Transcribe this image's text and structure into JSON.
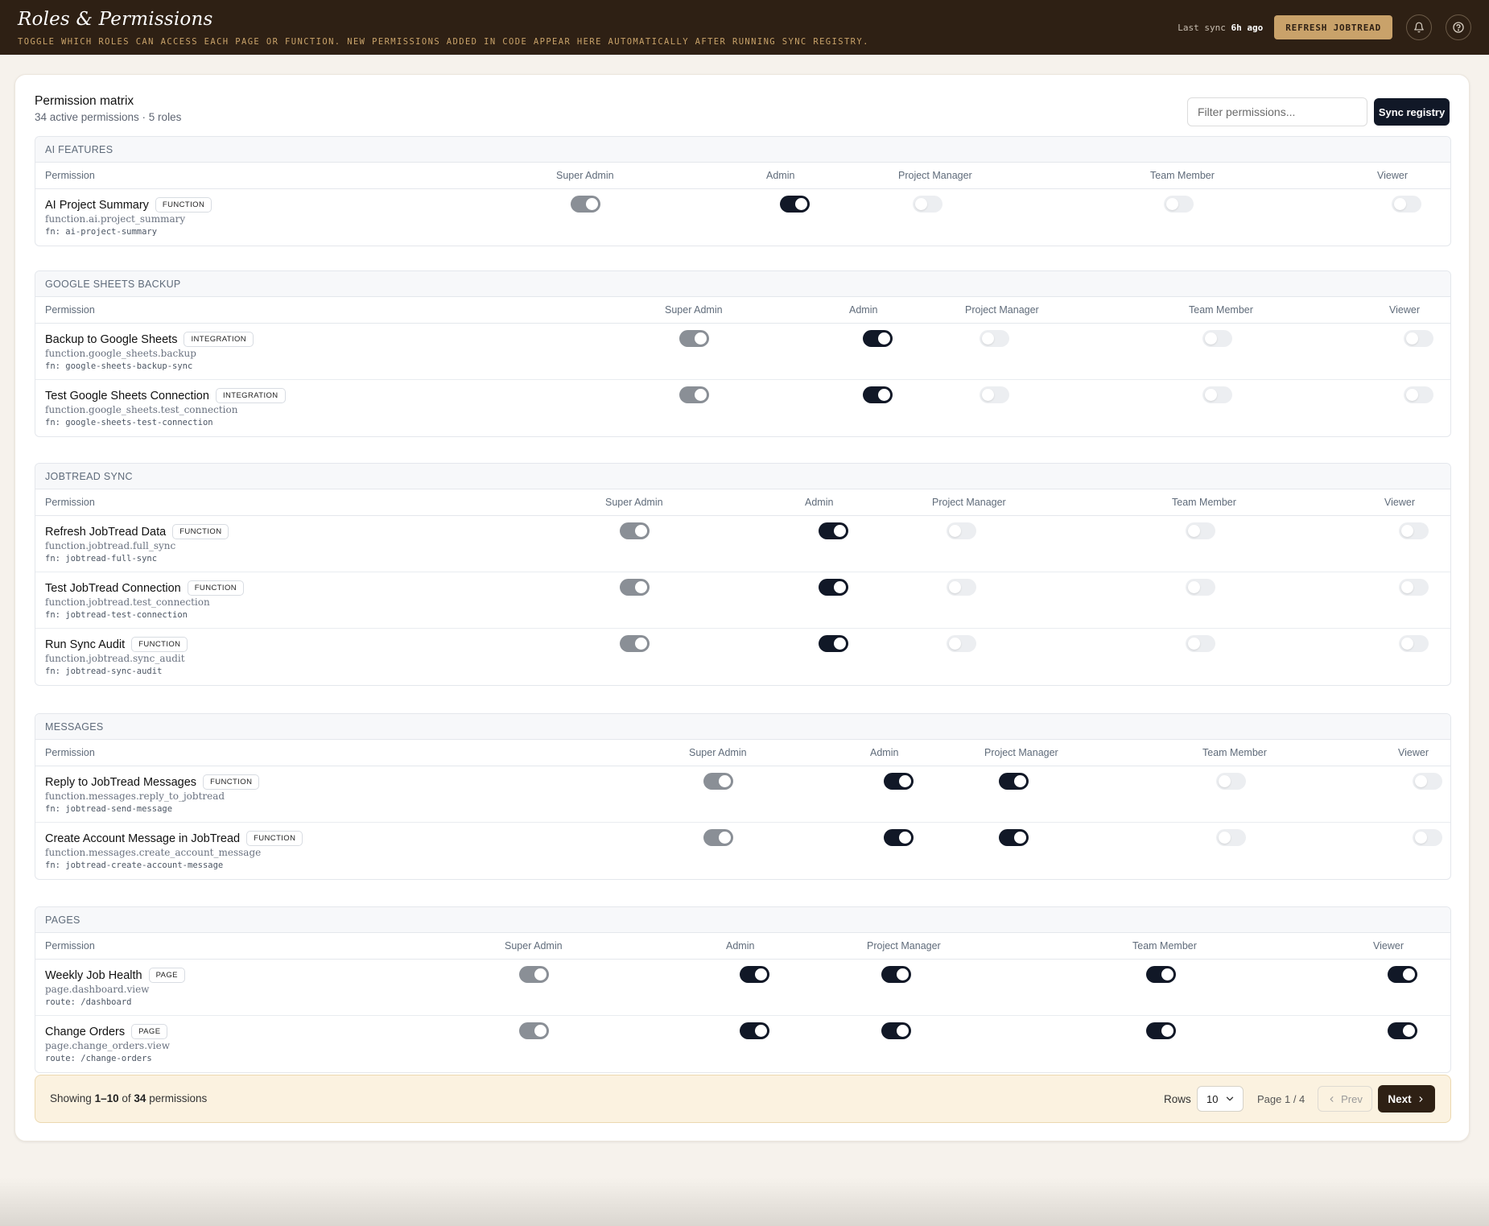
{
  "header": {
    "title": "Roles & Permissions",
    "subtitle": "TOGGLE WHICH ROLES CAN ACCESS EACH PAGE OR FUNCTION. NEW PERMISSIONS ADDED IN CODE APPEAR HERE AUTOMATICALLY AFTER RUNNING SYNC REGISTRY.",
    "last_sync_label": "Last sync",
    "last_sync_value": "6h ago",
    "refresh_label": "REFRESH JOBTREAD",
    "icons": [
      "bell-icon",
      "help-icon"
    ]
  },
  "matrix": {
    "title": "Permission matrix",
    "subtitle": "34 active permissions · 5 roles",
    "filter_placeholder": "Filter permissions...",
    "sync_label": "Sync registry",
    "permission_col": "Permission",
    "roles": [
      "Super Admin",
      "Admin",
      "Project Manager",
      "Team Member",
      "Viewer"
    ]
  },
  "sections": [
    {
      "name": "AI FEATURES",
      "rows": [
        {
          "name": "AI Project Summary",
          "badge": "FUNCTION",
          "key": "function.ai.project_summary",
          "ref": "fn: ai-project-summary",
          "states": [
            "locked",
            "on",
            "off",
            "off",
            "off"
          ]
        }
      ]
    },
    {
      "name": "GOOGLE SHEETS BACKUP",
      "rows": [
        {
          "name": "Backup to Google Sheets",
          "badge": "INTEGRATION",
          "key": "function.google_sheets.backup",
          "ref": "fn: google-sheets-backup-sync",
          "states": [
            "locked",
            "on",
            "off",
            "off",
            "off"
          ]
        },
        {
          "name": "Test Google Sheets Connection",
          "badge": "INTEGRATION",
          "key": "function.google_sheets.test_connection",
          "ref": "fn: google-sheets-test-connection",
          "states": [
            "locked",
            "on",
            "off",
            "off",
            "off"
          ]
        }
      ]
    },
    {
      "name": "JOBTREAD SYNC",
      "rows": [
        {
          "name": "Refresh JobTread Data",
          "badge": "FUNCTION",
          "key": "function.jobtread.full_sync",
          "ref": "fn: jobtread-full-sync",
          "states": [
            "locked",
            "on",
            "off",
            "off",
            "off"
          ]
        },
        {
          "name": "Test JobTread Connection",
          "badge": "FUNCTION",
          "key": "function.jobtread.test_connection",
          "ref": "fn: jobtread-test-connection",
          "states": [
            "locked",
            "on",
            "off",
            "off",
            "off"
          ]
        },
        {
          "name": "Run Sync Audit",
          "badge": "FUNCTION",
          "key": "function.jobtread.sync_audit",
          "ref": "fn: jobtread-sync-audit",
          "states": [
            "locked",
            "on",
            "off",
            "off",
            "off"
          ]
        }
      ]
    },
    {
      "name": "MESSAGES",
      "rows": [
        {
          "name": "Reply to JobTread Messages",
          "badge": "FUNCTION",
          "key": "function.messages.reply_to_jobtread",
          "ref": "fn: jobtread-send-message",
          "states": [
            "locked",
            "on",
            "on",
            "off",
            "off"
          ]
        },
        {
          "name": "Create Account Message in JobTread",
          "badge": "FUNCTION",
          "key": "function.messages.create_account_message",
          "ref": "fn: jobtread-create-account-message",
          "states": [
            "locked",
            "on",
            "on",
            "off",
            "off"
          ]
        }
      ]
    },
    {
      "name": "PAGES",
      "rows": [
        {
          "name": "Weekly Job Health",
          "badge": "PAGE",
          "key": "page.dashboard.view",
          "ref": "route: /dashboard",
          "states": [
            "locked",
            "on",
            "on",
            "on",
            "on"
          ]
        },
        {
          "name": "Change Orders",
          "badge": "PAGE",
          "key": "page.change_orders.view",
          "ref": "route: /change-orders",
          "states": [
            "locked",
            "on",
            "on",
            "on",
            "on"
          ]
        }
      ]
    }
  ],
  "footer": {
    "showing_prefix": "Showing",
    "range": "1–10",
    "of": "of",
    "total": "34",
    "suffix": "permissions",
    "rows_label": "Rows",
    "rows_value": "10",
    "page_info": "Page 1 / 4",
    "prev_label": "Prev",
    "next_label": "Next"
  }
}
